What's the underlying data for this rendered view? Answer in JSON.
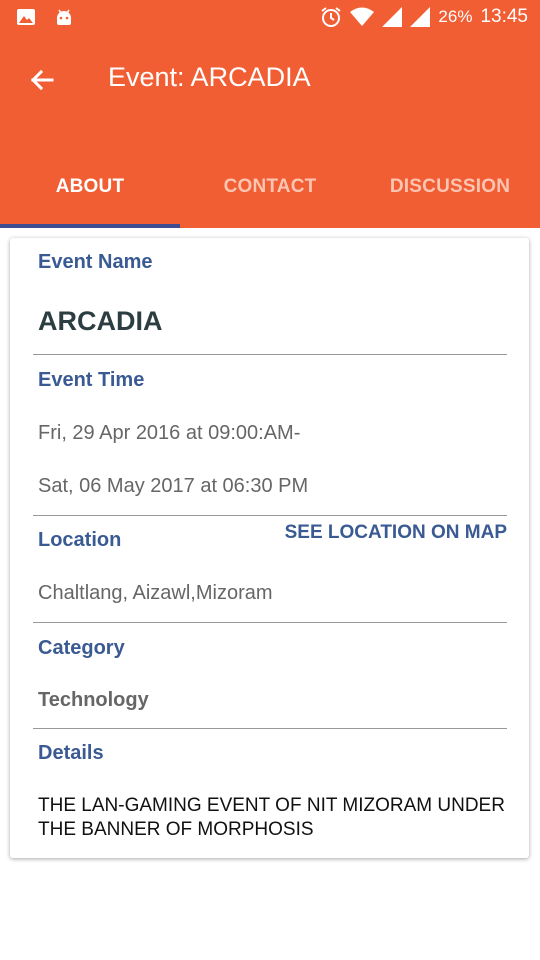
{
  "status_bar": {
    "battery": "26%",
    "time": "13:45",
    "icons": [
      "image-icon",
      "android-icon",
      "alarm-icon",
      "wifi-icon",
      "signal-icon",
      "signal-icon",
      "battery-icon"
    ]
  },
  "app_bar": {
    "title": "Event: ARCADIA",
    "back_icon": "arrow-back-icon"
  },
  "tabs": [
    {
      "label": "ABOUT",
      "selected": true
    },
    {
      "label": "CONTACT",
      "selected": false
    },
    {
      "label": "DISCUSSION",
      "selected": false
    }
  ],
  "event": {
    "name_label": "Event Name",
    "name": "ARCADIA",
    "time_label": "Event Time",
    "time_start": "Fri, 29 Apr 2016 at 09:00:AM-",
    "time_end": "Sat, 06 May 2017 at 06:30 PM",
    "location_label": "Location",
    "map_link": "SEE LOCATION ON MAP",
    "location": "Chaltlang, Aizawl,Mizoram",
    "category_label": "Category",
    "category": "Technology",
    "details_label": "Details",
    "details": "THE LAN-GAMING EVENT OF NIT MIZORAM UNDER THE BANNER OF MORPHOSIS"
  },
  "colors": {
    "primary": "#f15e34",
    "accent": "#3a5a93",
    "indicator": "#3d4d8f"
  }
}
